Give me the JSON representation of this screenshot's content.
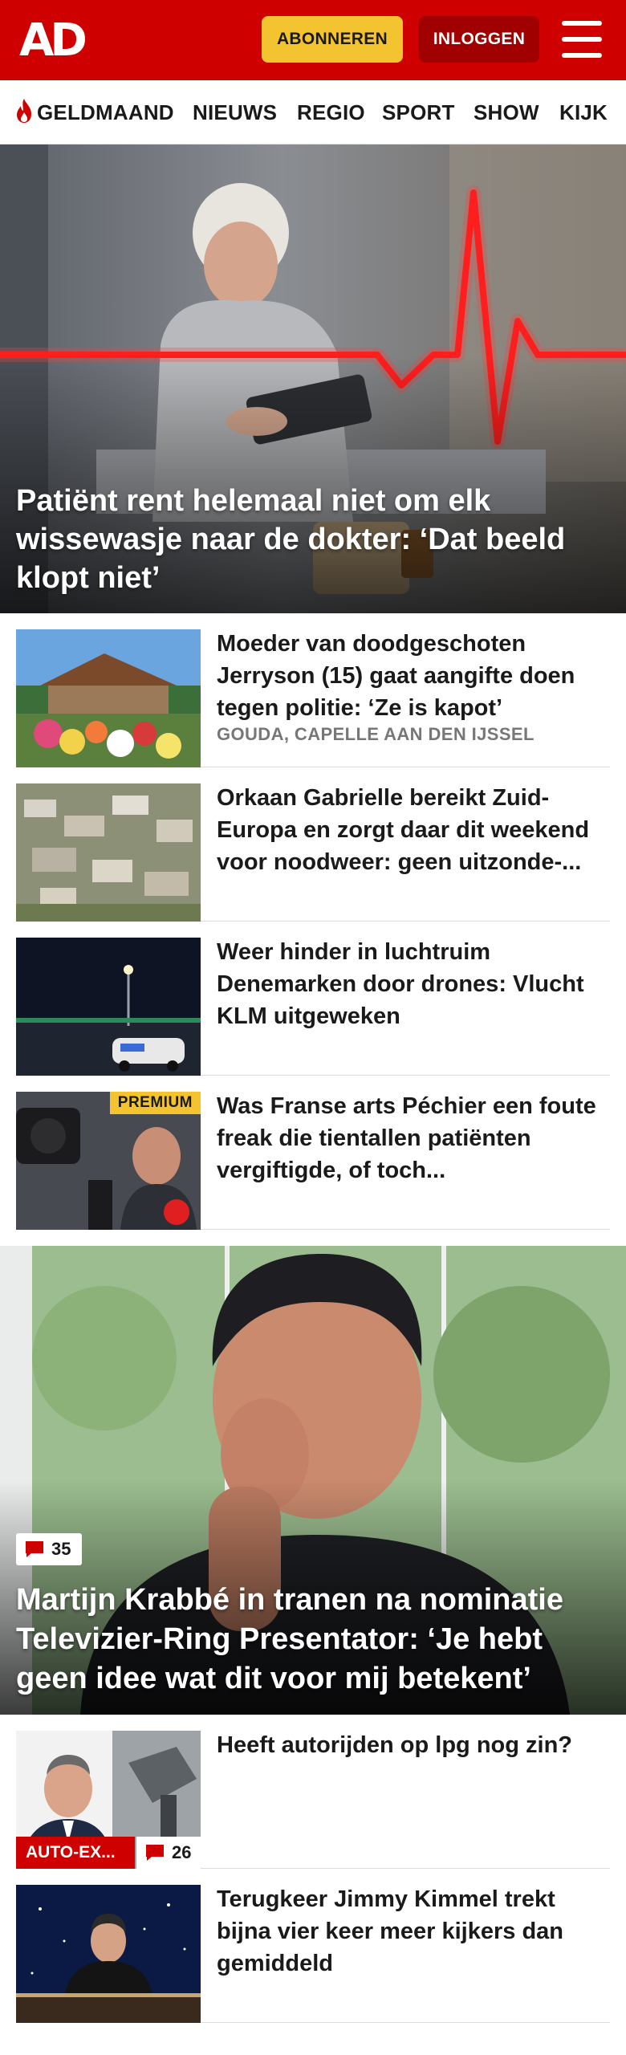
{
  "header": {
    "logo": "AD",
    "subscribe_label": "ABONNEREN",
    "login_label": "INLOGGEN",
    "menu_icon": "hamburger-menu-icon",
    "brand_color": "#cf0000",
    "accent_color": "#f4c430"
  },
  "nav": {
    "items": [
      {
        "label": "GELDMAAND",
        "icon": "flame-icon"
      },
      {
        "label": "NIEUWS"
      },
      {
        "label": "REGIO"
      },
      {
        "label": "SPORT"
      },
      {
        "label": "SHOW"
      },
      {
        "label": "KIJK"
      }
    ]
  },
  "hero": {
    "title": "Patiënt rent helemaal niet om elk wissewasje naar de dokter: ‘Dat beeld klopt niet’"
  },
  "articles": [
    {
      "title": "Moeder van doodgeschoten Jerryson (15) gaat aangifte doen tegen politie: ‘Ze is kapot’",
      "meta": "GOUDA, CAPELLE AAN DEN IJSSEL"
    },
    {
      "title": "Orkaan Gabrielle bereikt Zuid-Europa en zorgt daar dit weekend voor noodweer: geen uitzonde-..."
    },
    {
      "title": "Weer hinder in luchtruim Denemarken door drones: Vlucht KLM uitgeweken"
    },
    {
      "title": "Was Franse arts Péchier een foute freak die tientallen patiënten vergiftigde, of toch...",
      "badge": "PREMIUM"
    }
  ],
  "hero2": {
    "comments": "35",
    "title": "Martijn Krabbé in tranen na nominatie Televizier-Ring Presentator: ‘Je hebt geen idee wat dit voor mij betekent’"
  },
  "articles2": [
    {
      "title": "Heeft autorijden op lpg nog zin?",
      "tag": "AUTO-EX...",
      "comments": "26"
    },
    {
      "title": "Terugkeer Jimmy Kimmel trekt bijna vier keer meer kijkers dan gemiddeld"
    }
  ]
}
